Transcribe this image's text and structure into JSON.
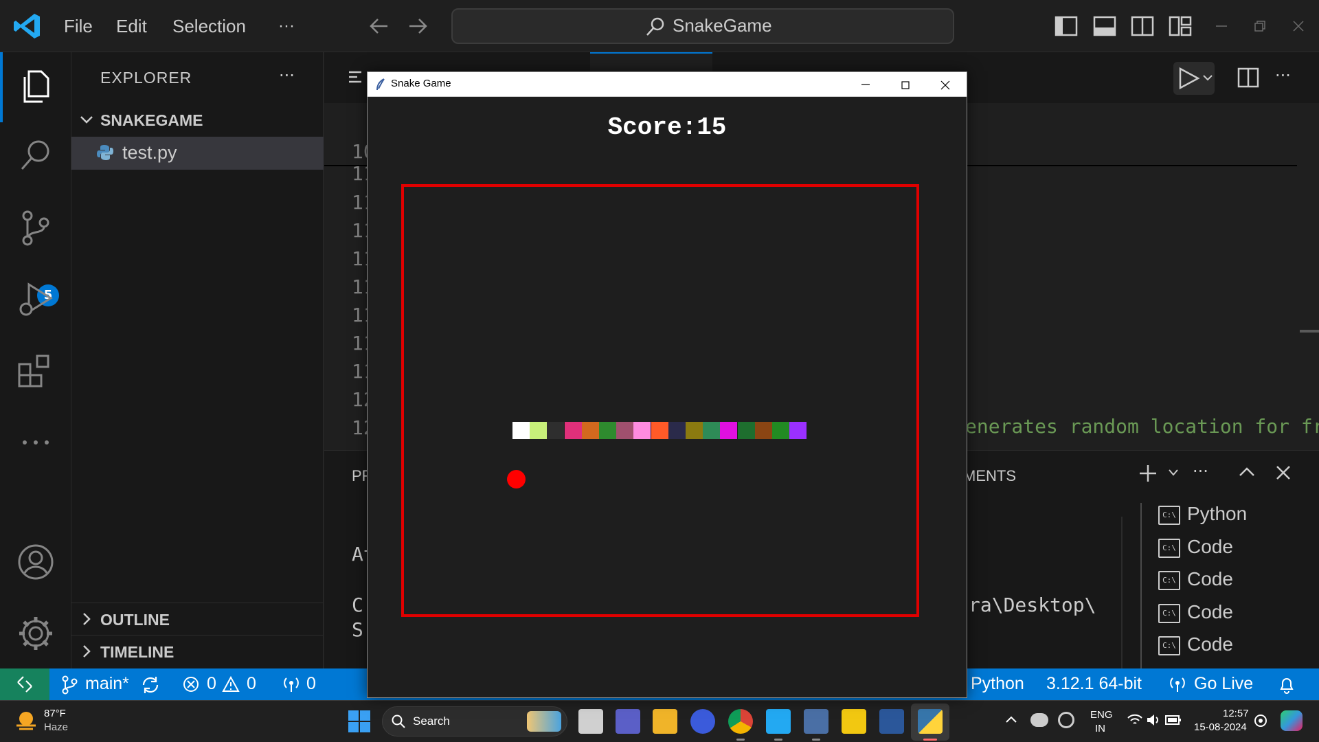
{
  "titlebar": {
    "menu": [
      "File",
      "Edit",
      "Selection",
      "···"
    ],
    "search_text": "SnakeGame"
  },
  "activity": {
    "scm_badge": "5"
  },
  "sidebar": {
    "title": "EXPLORER",
    "folder": "SNAKEGAME",
    "file": "test.py",
    "outline": "OUTLINE",
    "timeline": "TIMELINE"
  },
  "editor": {
    "line_numbers": [
      "10",
      "11",
      "11",
      "11",
      "11",
      "11",
      "11",
      "11",
      "11",
      "12",
      "12"
    ],
    "code_fragment": "enerates random location for fru"
  },
  "panel": {
    "tab_fragment": "MENTS",
    "left_frags": [
      "PR",
      "At",
      "C",
      "S"
    ],
    "path_fragment": "ra\\Desktop\\",
    "terminals": [
      "Python",
      "Code",
      "Code",
      "Code",
      "Code"
    ]
  },
  "statusbar": {
    "branch": "main*",
    "errors": "0",
    "warnings": "0",
    "ports": "0",
    "language": "Python",
    "interpreter": "3.12.1 64-bit",
    "golive": "Go Live"
  },
  "taskbar": {
    "weather_temp": "87°F",
    "weather_desc": "Haze",
    "search": "Search",
    "lang_line1": "ENG",
    "lang_line2": "IN",
    "time": "12:57",
    "date": "15-08-2024"
  },
  "snake_window": {
    "title": "Snake Game",
    "score_text": "Score:15",
    "snake_colors": [
      "#ffffff",
      "#c8f07a",
      "#2e2e2e",
      "#e0307a",
      "#d2691e",
      "#2e8b2e",
      "#a0506e",
      "#ff8ce0",
      "#ff5a28",
      "#2a2a4a",
      "#8b7a10",
      "#2e8b57",
      "#e010e0",
      "#1e6e2e",
      "#8b4513",
      "#228b22",
      "#9b30ff"
    ]
  }
}
